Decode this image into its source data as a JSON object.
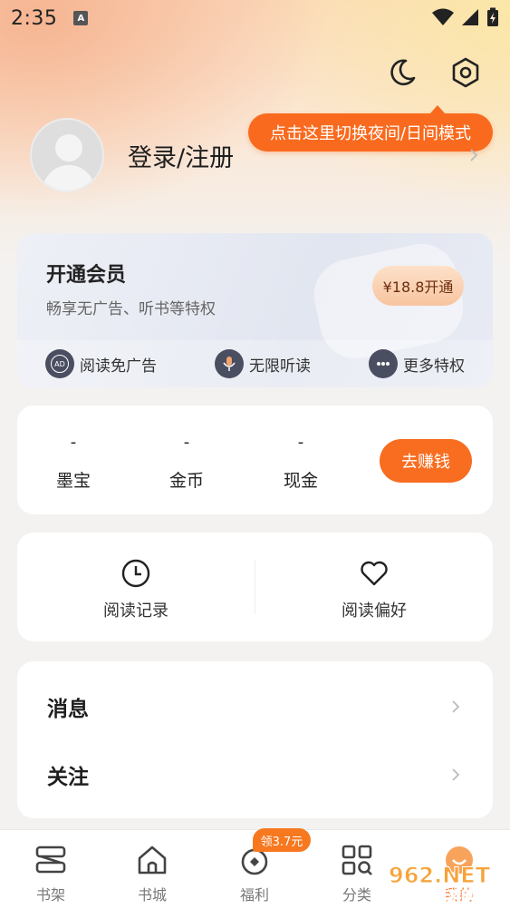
{
  "status_bar": {
    "time": "2:35",
    "app_icon_letter": "A"
  },
  "header": {
    "tooltip": "点击这里切换夜间/日间模式",
    "login_label": "登录/注册"
  },
  "vip": {
    "title": "开通会员",
    "subtitle": "畅享无广告、听书等特权",
    "button": "¥18.8开通",
    "perks": [
      {
        "icon": "ad-free-icon",
        "icon_text": "AD",
        "label": "阅读免广告"
      },
      {
        "icon": "microphone-icon",
        "label": "无限听读"
      },
      {
        "icon": "more-dots-icon",
        "label": "更多特权"
      }
    ]
  },
  "wallet": {
    "items": [
      {
        "value": "-",
        "label": "墨宝"
      },
      {
        "value": "-",
        "label": "金币"
      },
      {
        "value": "-",
        "label": "现金"
      }
    ],
    "earn_button": "去赚钱"
  },
  "reading": {
    "history_label": "阅读记录",
    "preference_label": "阅读偏好"
  },
  "menu": {
    "items": [
      {
        "label": "消息"
      },
      {
        "label": "关注"
      }
    ]
  },
  "tabbar": {
    "badge": "领3.7元",
    "tabs": [
      {
        "label": "书架",
        "icon": "bookshelf-icon"
      },
      {
        "label": "书城",
        "icon": "home-icon"
      },
      {
        "label": "福利",
        "icon": "gift-icon"
      },
      {
        "label": "分类",
        "icon": "category-icon"
      },
      {
        "label": "我的",
        "icon": "profile-icon"
      }
    ]
  },
  "watermark": {
    "text_top": "962.NET",
    "text_bottom": "乐游网"
  },
  "colors": {
    "accent": "#f86d20",
    "vip_button": "#f8c49f",
    "background": "#f3f2f1"
  }
}
